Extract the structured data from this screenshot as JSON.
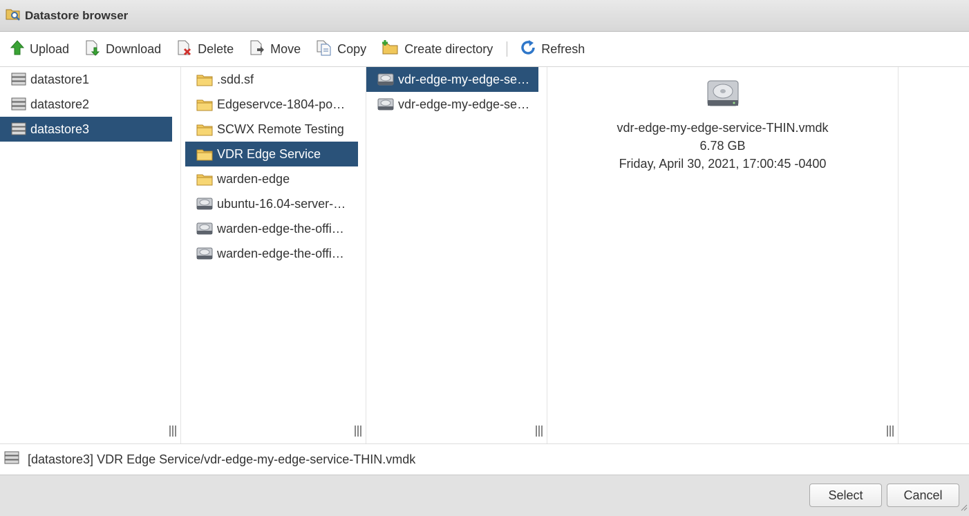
{
  "window": {
    "title": "Datastore browser",
    "icon": "datastore-browser-icon"
  },
  "toolbar": {
    "upload": "Upload",
    "download": "Download",
    "delete": "Delete",
    "move": "Move",
    "copy": "Copy",
    "create_directory": "Create directory",
    "refresh": "Refresh"
  },
  "datastores": [
    {
      "label": "datastore1",
      "selected": false
    },
    {
      "label": "datastore2",
      "selected": false
    },
    {
      "label": "datastore3",
      "selected": true
    }
  ],
  "folder_contents": [
    {
      "label": ".sdd.sf",
      "type": "folder"
    },
    {
      "label": "Edgeservce-1804-po…",
      "type": "folder"
    },
    {
      "label": "SCWX Remote Testing",
      "type": "folder"
    },
    {
      "label": "VDR Edge Service",
      "type": "folder",
      "selected": true
    },
    {
      "label": "warden-edge",
      "type": "folder"
    },
    {
      "label": "ubuntu-16.04-server-…",
      "type": "disk"
    },
    {
      "label": "warden-edge-the-offi…",
      "type": "disk"
    },
    {
      "label": "warden-edge-the-offi…",
      "type": "disk"
    }
  ],
  "subfolder_contents": [
    {
      "label": "vdr-edge-my-edge-se…",
      "type": "disk",
      "selected": true
    },
    {
      "label": "vdr-edge-my-edge-se…",
      "type": "disk"
    }
  ],
  "preview": {
    "icon": "hard-disk-icon",
    "filename": "vdr-edge-my-edge-service-THIN.vmdk",
    "size": "6.78 GB",
    "modified": "Friday, April 30, 2021, 17:00:45 -0400"
  },
  "path": "[datastore3] VDR Edge Service/vdr-edge-my-edge-service-THIN.vmdk",
  "buttons": {
    "select": "Select",
    "cancel": "Cancel"
  },
  "colors": {
    "selection": "#2a5279",
    "footer": "#e2e2e2"
  }
}
